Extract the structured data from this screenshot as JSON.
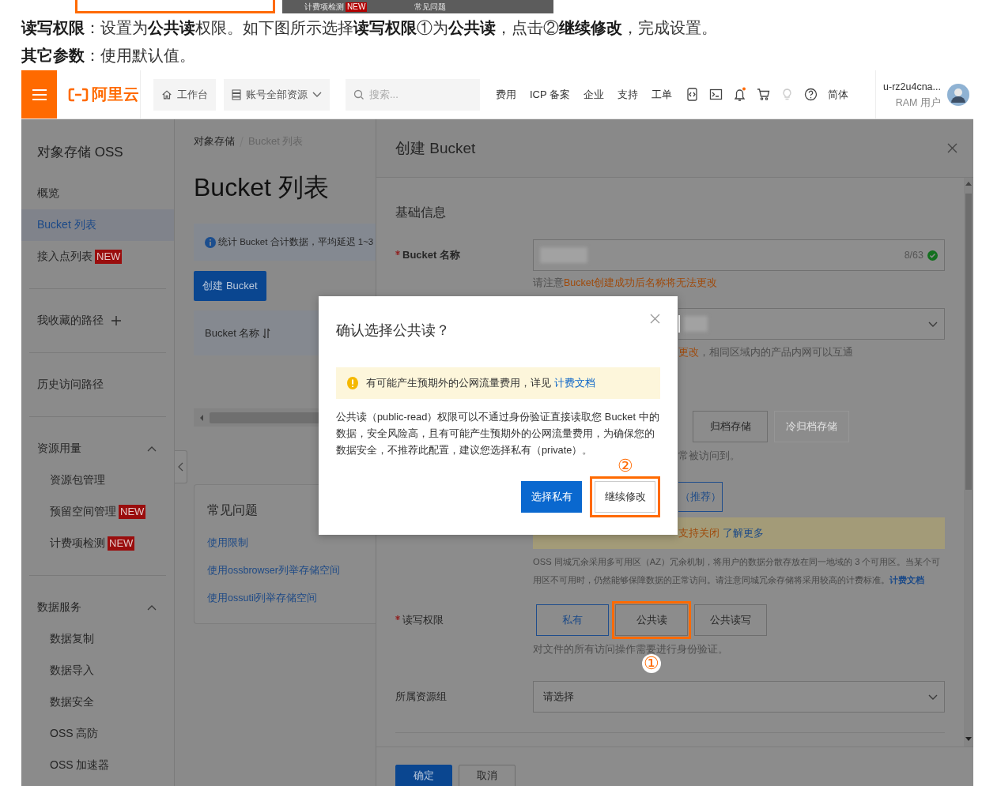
{
  "prev_figure": {
    "billing_check": "计费项检测",
    "badge": "NEW",
    "faq": "常见问题"
  },
  "instructions": [
    "**读写权限**：设置为**公共读**权限。如下图所示选择**读写权限**①为**公共读**，点击②**继续修改**，完成设置。",
    "**其它参数**：使用默认值。"
  ],
  "console": {
    "nav": {
      "logo": "阿里云",
      "workbench": "工作台",
      "resources": "账号全部资源",
      "search_placeholder": "搜索...",
      "links": [
        "费用",
        "ICP 备案",
        "企业",
        "支持",
        "工单"
      ],
      "language": "简体",
      "user": {
        "name": "u-rz2u4cna...",
        "role": "RAM 用户"
      }
    },
    "sidebar": {
      "title": "对象存储 OSS",
      "sections": [
        {
          "kind": "links",
          "items": [
            {
              "label": "概览",
              "selected": false
            },
            {
              "label": "Bucket 列表",
              "selected": true
            },
            {
              "label": "接入点列表",
              "badge": "NEW",
              "selected": false
            }
          ]
        },
        {
          "kind": "favorites",
          "label": "我收藏的路径"
        },
        {
          "kind": "plain",
          "label": "历史访问路径"
        },
        {
          "kind": "group",
          "label": "资源用量",
          "expanded": true,
          "items": [
            {
              "label": "资源包管理",
              "selected": false
            },
            {
              "label": "预留空间管理",
              "badge": "NEW",
              "selected": false
            },
            {
              "label": "计费项检测",
              "badge": "NEW",
              "selected": false
            }
          ]
        },
        {
          "kind": "group",
          "label": "数据服务",
          "expanded": true,
          "items": [
            {
              "label": "数据复制",
              "selected": false
            },
            {
              "label": "数据导入",
              "selected": false
            },
            {
              "label": "数据安全",
              "selected": false
            },
            {
              "label": "OSS 高防",
              "selected": false
            },
            {
              "label": "OSS 加速器",
              "selected": false
            }
          ]
        }
      ]
    },
    "bucket_list": {
      "breadcrumb": [
        "对象存储",
        "Bucket 列表"
      ],
      "title": "Bucket 列表",
      "info": "统计 Bucket 合计数据，平均延迟 1~3",
      "create_button": "创建 Bucket",
      "table": {
        "columns": [
          "Bucket 名称"
        ]
      },
      "faq": {
        "title": "常见问题",
        "links": [
          "使用限制",
          "使用ossbrowser列举存储空间",
          "使用ossutil列举存储空间"
        ]
      }
    },
    "drawer": {
      "title": "创建 Bucket",
      "section": "基础信息",
      "name_field": {
        "label": "Bucket 名称",
        "required": true,
        "counter": "8/63",
        "valid": true
      },
      "name_hint": {
        "text": "请注意",
        "emphasis": "Bucket创建成功后名称将无法更改"
      },
      "region_hint": {
        "emphasis": "更改",
        "text": "，相同区域内的产品内网可以互通"
      },
      "storage_classes": [
        {
          "label": "归档存储",
          "disabled": false
        },
        {
          "label": "冷归档存储",
          "disabled": true
        }
      ],
      "storage_hint": "常被访问到。",
      "redundancy_option": {
        "label": "（推荐）",
        "selected": true
      },
      "redundancy_notice": {
        "text": "支持关闭",
        "link": "了解更多"
      },
      "redundancy_description": {
        "text": "OSS 同城冗余采用多可用区（AZ）冗余机制，将用户的数据分散存放在同一地域的 3 个可用区。当某个可用区不可用时，仍然能够保障数据的正常访问。请注意同城冗余存储将采用较高的计费标准。",
        "link": "计费文档"
      },
      "acl": {
        "label": "读写权限",
        "required": true,
        "options": [
          {
            "label": "私有",
            "selected": true,
            "highlighted": false
          },
          {
            "label": "公共读",
            "selected": false,
            "highlighted": true,
            "marker": "①"
          },
          {
            "label": "公共读写",
            "selected": false,
            "highlighted": false
          }
        ],
        "hint": "对文件的所有访问操作需要进行身份验证。"
      },
      "resource_group": {
        "label": "所属资源组",
        "placeholder": "请选择"
      },
      "buttons": [
        {
          "label": "确定",
          "kind": "primary"
        },
        {
          "label": "取消",
          "kind": "default"
        }
      ]
    },
    "modal": {
      "title": "确认选择公共读？",
      "warning": {
        "text": "有可能产生预期外的公网流量费用，详见",
        "link": "计费文档"
      },
      "body": "公共读（public-read）权限可以不通过身份验证直接读取您 Bucket 中的数据，安全风险高，且有可能产生预期外的公网流量费用，为确保您的数据安全，不推荐此配置，建议您选择私有（private）。",
      "buttons": [
        {
          "label": "选择私有",
          "kind": "primary",
          "highlighted": false
        },
        {
          "label": "继续修改",
          "kind": "default",
          "highlighted": true,
          "marker": "②"
        }
      ]
    }
  }
}
